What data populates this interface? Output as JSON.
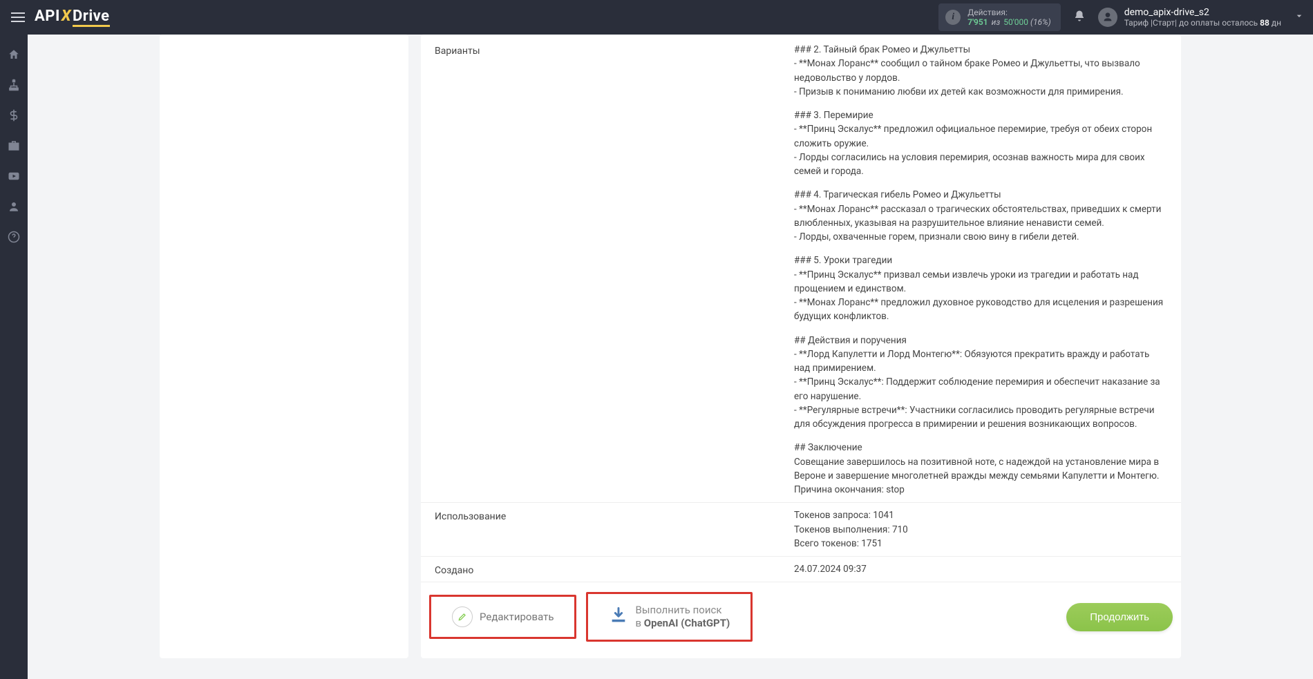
{
  "logo": {
    "part1": "API",
    "x": "X",
    "part2": "Drive"
  },
  "header": {
    "actions_label": "Действия:",
    "actions_used": "7'951",
    "actions_sep": "из",
    "actions_total": "50'000",
    "actions_pct": "(16%)",
    "username": "demo_apix-drive_s2",
    "tariff_prefix": "Тариф |Старт| до оплаты осталось",
    "tariff_days": "88",
    "tariff_suffix": "дн"
  },
  "rows": {
    "variants_label": "Варианты",
    "usage_label": "Использование",
    "created_label": "Создано",
    "created_value": "24.07.2024 09:37"
  },
  "variants": {
    "s2_title": "### 2. Тайный брак Ромео и Джульетты",
    "s2_l1": "- **Монах Лоранс** сообщил о тайном браке Ромео и Джульетты, что вызвало недовольство у лордов.",
    "s2_l2": "- Призыв к пониманию любви их детей как возможности для примирения.",
    "s3_title": "### 3. Перемирие",
    "s3_l1": "- **Принц Эскалус** предложил официальное перемирие, требуя от обеих сторон сложить оружие.",
    "s3_l2": "- Лорды согласились на условия перемирия, осознав важность мира для своих семей и города.",
    "s4_title": "### 4. Трагическая гибель Ромео и Джульетты",
    "s4_l1": "- **Монах Лоранс** рассказал о трагических обстоятельствах, приведших к смерти влюбленных, указывая на разрушительное влияние ненависти семей.",
    "s4_l2": "- Лорды, охваченные горем, признали свою вину в гибели детей.",
    "s5_title": "### 5. Уроки трагедии",
    "s5_l1": "- **Принц Эскалус** призвал семьи извлечь уроки из трагедии и работать над прощением и единством.",
    "s5_l2": "- **Монах Лоранс** предложил духовное руководство для исцеления и разрешения будущих конфликтов.",
    "act_title": "## Действия и поручения",
    "act_l1": "- **Лорд Капулетти и Лорд Монтегю**: Обязуются прекратить вражду и работать над примирением.",
    "act_l2": "- **Принц Эскалус**: Поддержит соблюдение перемирия и обеспечит наказание за его нарушение.",
    "act_l3": "- **Регулярные встречи**: Участники согласились проводить регулярные встречи для обсуждения прогресса в примирении и решения возникающих вопросов.",
    "con_title": "## Заключение",
    "con_l1": "Совещание завершилось на позитивной ноте, с надеждой на установление мира в Вероне и завершение многолетней вражды между семьями Капулетти и Монтегю.",
    "finish_reason": "Причина окончания: stop"
  },
  "usage": {
    "l1": "Токенов запроса: 1041",
    "l2": "Токенов выполнения: 710",
    "l3": "Всего токенов: 1751"
  },
  "buttons": {
    "edit": "Редактировать",
    "search_l1": "Выполнить поиск",
    "search_l2_prefix": "в ",
    "search_l2_bold": "OpenAI (ChatGPT)",
    "continue": "Продолжить"
  }
}
